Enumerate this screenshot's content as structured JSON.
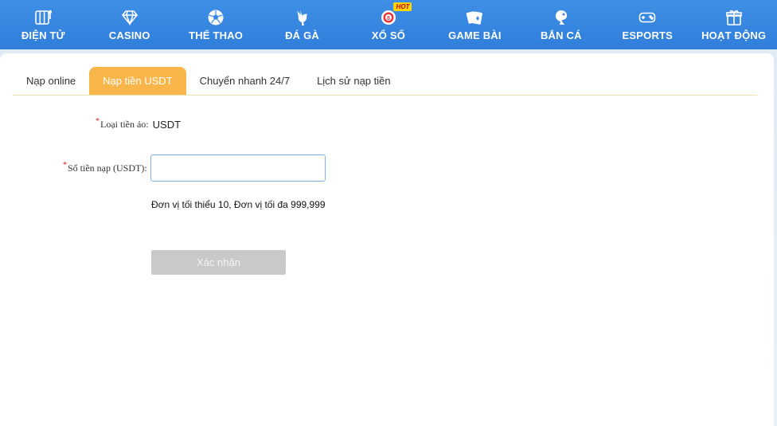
{
  "nav": {
    "items": [
      {
        "label": "ĐIỆN TỬ",
        "icon": "slot-machine-icon"
      },
      {
        "label": "CASINO",
        "icon": "diamond-icon"
      },
      {
        "label": "THỂ THAO",
        "icon": "soccer-ball-icon"
      },
      {
        "label": "ĐÁ GÀ",
        "icon": "rooster-icon"
      },
      {
        "label": "XỔ SỐ",
        "icon": "lottery-ball-icon",
        "badge": "HOT",
        "ball_number": "8"
      },
      {
        "label": "GAME BÀI",
        "icon": "playing-cards-icon"
      },
      {
        "label": "BẮN CÁ",
        "icon": "fish-icon"
      },
      {
        "label": "ESPORTS",
        "icon": "gamepad-icon"
      },
      {
        "label": "HOẠT ĐỘNG",
        "icon": "gift-icon"
      }
    ]
  },
  "tabs": [
    {
      "label": "Nạp online",
      "active": false
    },
    {
      "label": "Nạp tiền USDT",
      "active": true
    },
    {
      "label": "Chuyển nhanh 24/7",
      "active": false
    },
    {
      "label": "Lịch sử nạp tiền",
      "active": false
    }
  ],
  "form": {
    "required_mark": "*",
    "currency_label": "Loại tiền ảo:",
    "currency_value": "USDT",
    "amount_label": "Số tiền nạp (USDT):",
    "amount_value": "",
    "hint": "Đơn vị tối thiểu 10, Đơn vị tối đa 999,999",
    "confirm_label": "Xác nhận"
  },
  "colors": {
    "nav_bg": "#3a88e3",
    "active_tab": "#f8b64a",
    "button_disabled": "#c9c9c9",
    "required": "#e02020"
  }
}
